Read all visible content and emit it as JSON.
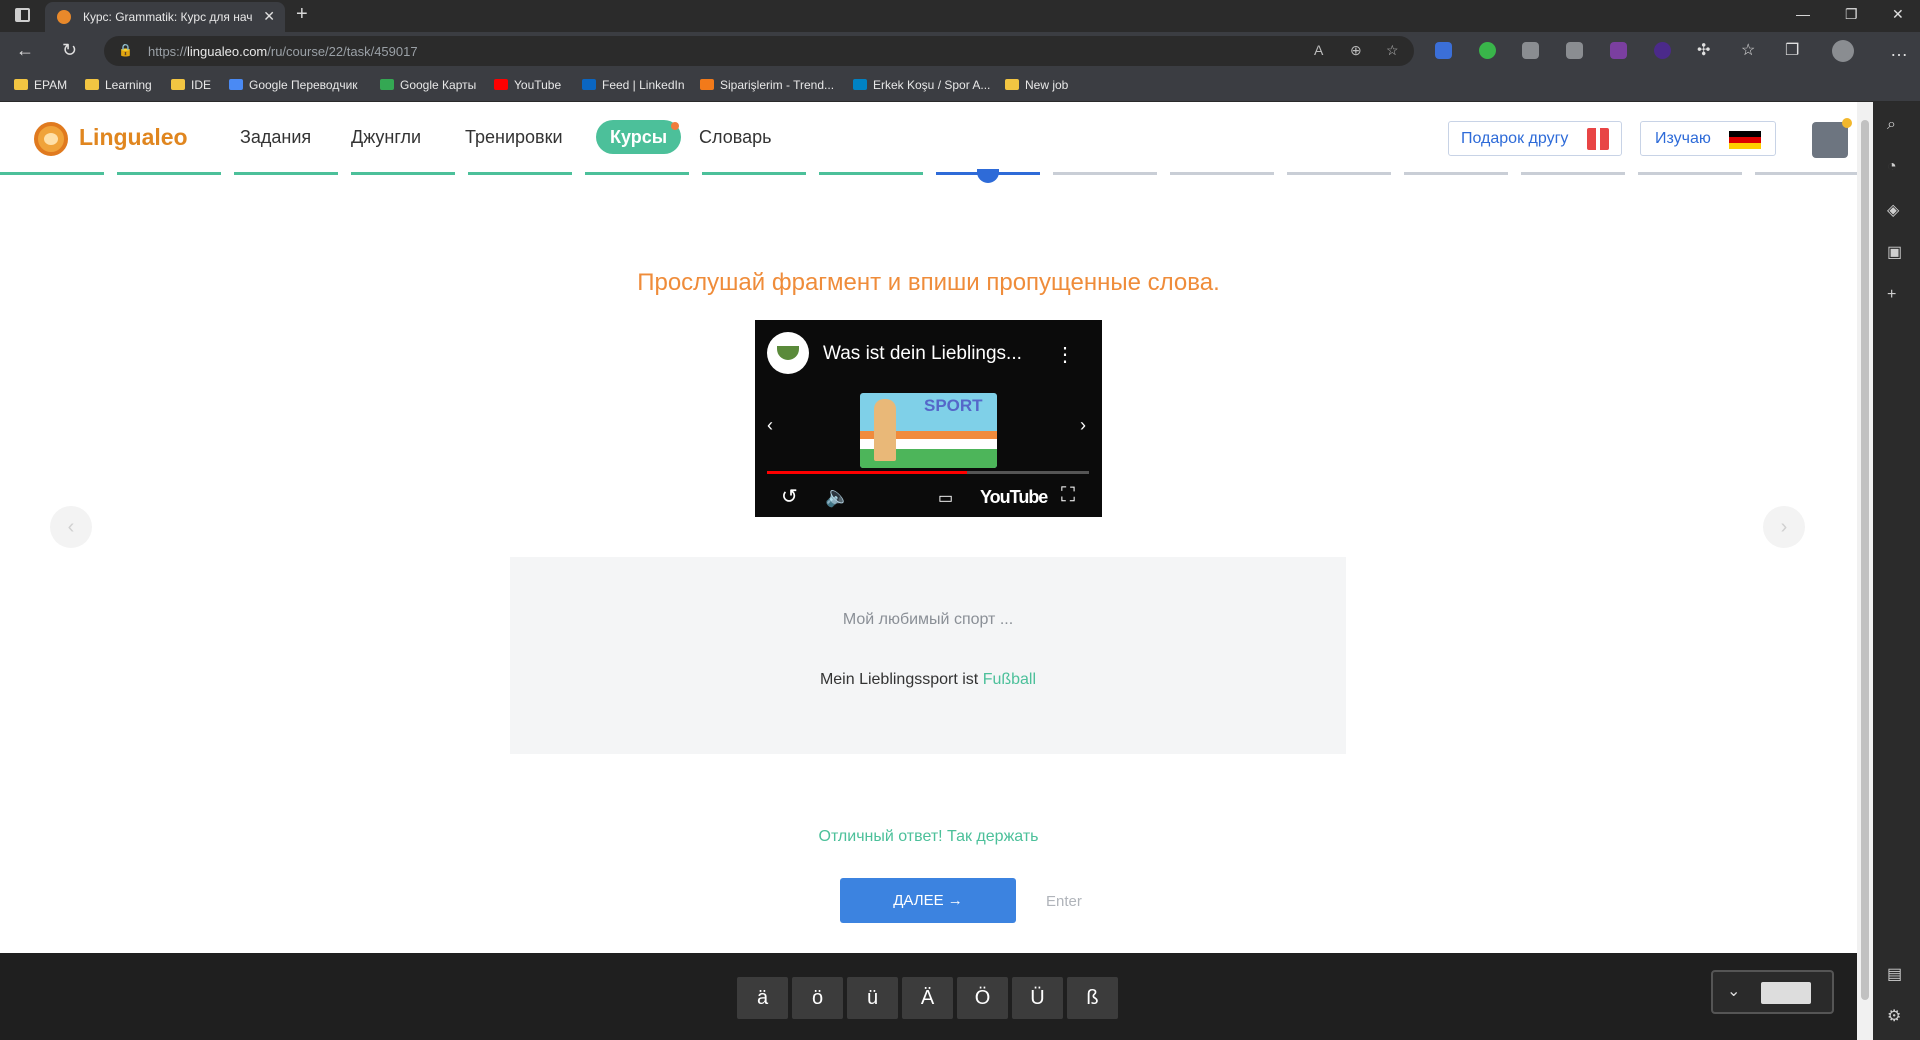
{
  "browser": {
    "tab_title": "Курс: Grammatik: Курс для начинающих",
    "url_prefix": "https://",
    "url_host": "lingualeo.com",
    "url_path": "/ru/course/22/task/459017",
    "bookmarks": [
      {
        "label": "EPAM",
        "icon": "folder-icon",
        "color": "#f2c542"
      },
      {
        "label": "Learning",
        "icon": "folder-icon",
        "color": "#f2c542"
      },
      {
        "label": "IDE",
        "icon": "folder-icon",
        "color": "#f2c542"
      },
      {
        "label": "Google Переводчик",
        "icon": "google-translate-icon",
        "color": "#4a8af4"
      },
      {
        "label": "Google Карты",
        "icon": "google-maps-icon",
        "color": "#34a853"
      },
      {
        "label": "YouTube",
        "icon": "youtube-icon",
        "color": "#ff0000"
      },
      {
        "label": "Feed | LinkedIn",
        "icon": "linkedin-icon",
        "color": "#0a66c2"
      },
      {
        "label": "Siparişlerim - Trend...",
        "icon": "trendyol-icon",
        "color": "#f27a1a"
      },
      {
        "label": "Erkek Koşu / Spor A...",
        "icon": "decathlon-icon",
        "color": "#0082c3"
      },
      {
        "label": "New job",
        "icon": "folder-icon",
        "color": "#f2c542"
      }
    ]
  },
  "site": {
    "logo": "Lingualeo",
    "nav": [
      "Задания",
      "Джунгли",
      "Тренировки",
      "Курсы",
      "Словарь"
    ],
    "active_nav": "Курсы",
    "gift_button": "Подарок другу",
    "lang_button": "Изучаю",
    "flag_colors": [
      "#000000",
      "#dd0000",
      "#ffce00"
    ],
    "accent_green": "#4cc09a",
    "accent_blue": "#3c83e0",
    "accent_orange": "#ef8c3a"
  },
  "progress": {
    "total_segments": 16,
    "done_segments": 8,
    "current_segment": 9
  },
  "task": {
    "instruction": "Прослушай фрагмент и впиши пропущенные слова.",
    "video_title": "Was ist dein Lieblings...",
    "video_thumb_text": "SPORT",
    "video_brand": "YouTube",
    "video_progress": 0.62,
    "question": "Мой любимый спорт ...",
    "answer_prefix": "Mein Lieblingssport ist",
    "answer_word": "Fußball",
    "feedback": "Отличный ответ! Так держать",
    "next_button": "ДАЛЕЕ →",
    "enter_hint": "Enter"
  },
  "keyboard": {
    "keys": [
      "ä",
      "ö",
      "ü",
      "Ä",
      "Ö",
      "Ü",
      "ß"
    ]
  }
}
